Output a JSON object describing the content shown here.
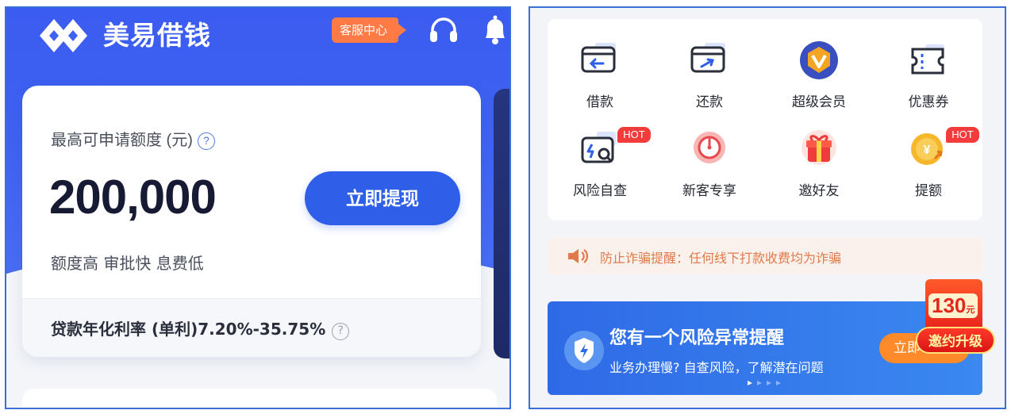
{
  "left": {
    "app_title": "美易借钱",
    "service_label": "客服中心",
    "card": {
      "limit_label": "最高可申请额度 (元)",
      "help_glyph": "?",
      "amount": "200,000",
      "cta_label": "立即提现",
      "tagline": "额度高 审批快 息费低",
      "rate_text": "贷款年化利率 (单利)7.20%-35.75%",
      "rate_help_glyph": "?"
    }
  },
  "right": {
    "grid": [
      {
        "label": "借款",
        "icon": "borrow-icon"
      },
      {
        "label": "还款",
        "icon": "repay-icon"
      },
      {
        "label": "超级会员",
        "icon": "vip-icon"
      },
      {
        "label": "优惠券",
        "icon": "coupon-icon"
      },
      {
        "label": "风险自查",
        "icon": "risk-check-icon",
        "hot": "HOT"
      },
      {
        "label": "新客专享",
        "icon": "new-customer-icon"
      },
      {
        "label": "邀好友",
        "icon": "gift-icon"
      },
      {
        "label": "提额",
        "icon": "raise-limit-icon",
        "hot": "HOT"
      }
    ],
    "notice": "防止诈骗提醒：任何线下打款收费均为诈骗",
    "alert": {
      "title": "您有一个风险异常提醒",
      "subtitle": "业务办理慢? 自查风险，了解潜在问题",
      "button": "立即"
    },
    "promo": {
      "amount": "130",
      "unit": "元",
      "tag": "邀约升级"
    }
  },
  "colors": {
    "brand_blue": "#3f62f2",
    "cta_blue": "#2f5fe8",
    "hot_red": "#f23b3b",
    "notice_orange": "#e07a4a"
  }
}
